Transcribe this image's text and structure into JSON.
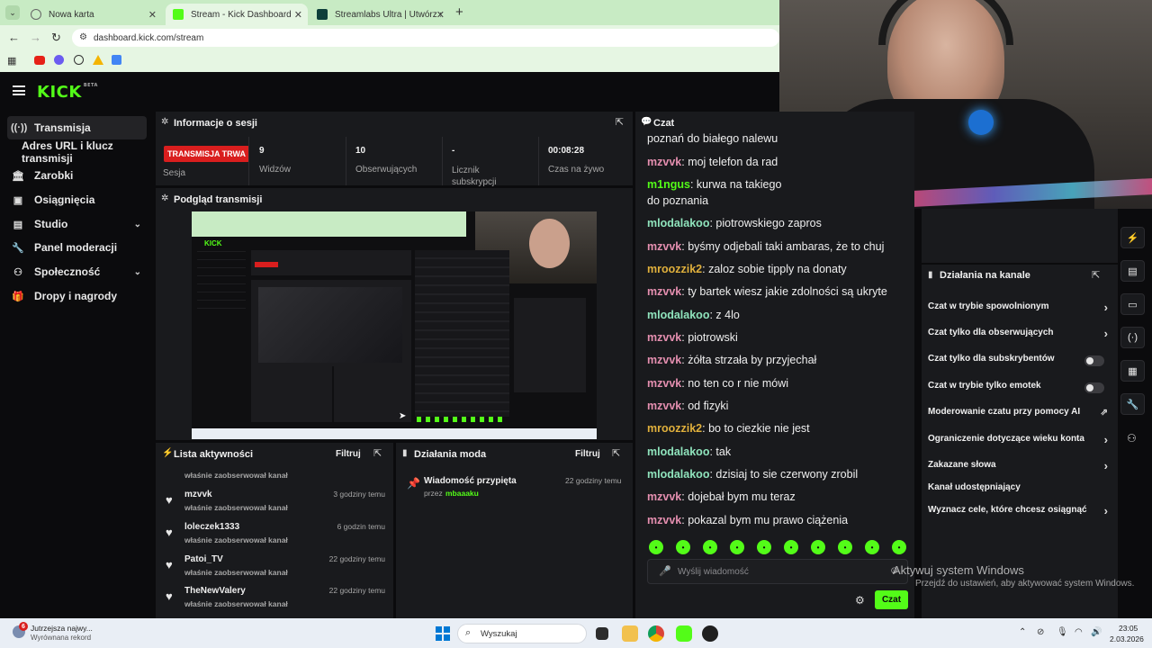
{
  "browser": {
    "tabs": [
      {
        "title": "Nowa karta"
      },
      {
        "title": "Stream - Kick Dashboard"
      },
      {
        "title": "Streamlabs Ultra | Utwórz subsk"
      }
    ],
    "url": "dashboard.kick.com/stream",
    "new_tab_label": "+"
  },
  "app": {
    "logo_text": "KICK",
    "logo_beta": "BETA"
  },
  "sidebar": {
    "items": [
      {
        "label": "Transmisja",
        "icon": "broadcast-icon"
      },
      {
        "label": "Adres URL i klucz transmisji"
      },
      {
        "label": "Zarobki",
        "icon": "bank-icon"
      },
      {
        "label": "Osiągnięcia",
        "icon": "trophy-icon"
      },
      {
        "label": "Studio",
        "icon": "studio-icon"
      },
      {
        "label": "Panel moderacji",
        "icon": "wrench-icon"
      },
      {
        "label": "Społeczność",
        "icon": "community-icon"
      },
      {
        "label": "Dropy i nagrody",
        "icon": "gift-icon"
      }
    ]
  },
  "session": {
    "title": "Informacje o sesji",
    "live_badge": "TRANSMISJA TRWA",
    "session_label": "Sesja",
    "viewers_value": "9",
    "viewers_label": "Widzów",
    "followers_value": "10",
    "followers_label": "Obserwujących",
    "subs_value": "-",
    "subs_label": "Licznik subskrypcji",
    "time_value": "00:08:28",
    "time_label": "Czas na żywo"
  },
  "preview": {
    "title": "Podgląd transmisji"
  },
  "activity": {
    "title": "Lista aktywności",
    "filter_label": "Filtruj",
    "partial_sub": "właśnie zaobserwował kanał",
    "rows": [
      {
        "name": "mzvvk",
        "sub": "właśnie zaobserwował kanał",
        "time": "3 godziny temu"
      },
      {
        "name": "loleczek1333",
        "sub": "właśnie zaobserwował kanał",
        "time": "6 godzin temu"
      },
      {
        "name": "Patoi_TV",
        "sub": "właśnie zaobserwował kanał",
        "time": "22 godziny temu"
      },
      {
        "name": "TheNewValery",
        "sub": "właśnie zaobserwował kanał",
        "time": "22 godziny temu"
      }
    ]
  },
  "mod_actions": {
    "title": "Działania moda",
    "filter_label": "Filtruj",
    "item_title": "Wiadomość przypięta",
    "item_by": "przez",
    "item_user": "mbaaaku",
    "item_time": "22 godziny temu"
  },
  "chat": {
    "title": "Czat",
    "lines": [
      {
        "user": "",
        "text": "poznań do białego nalewu",
        "color": "#efefef"
      },
      {
        "user": "mzvvk",
        "text": "moj telefon da rad",
        "color": "#e58fb0"
      },
      {
        "user": "m1ngus",
        "text": "kurwa na takiego",
        "color": "#53fc18"
      },
      {
        "user": "",
        "text": "do poznania",
        "color": "#efefef"
      },
      {
        "user": "mlodalakoo",
        "text": "piotrowskiego zapros",
        "color": "#8fe3bc"
      },
      {
        "user": "mzvvk",
        "text": "byśmy odjebali taki ambaras, że to chuj",
        "color": "#e58fb0"
      },
      {
        "user": "mroozzik2",
        "text": "zaloz sobie tipply na donaty",
        "color": "#e0b03c"
      },
      {
        "user": "mzvvk",
        "text": "ty bartek wiesz jakie zdolności są ukryte",
        "color": "#e58fb0"
      },
      {
        "user": "mlodalakoo",
        "text": "z 4lo",
        "color": "#8fe3bc"
      },
      {
        "user": "mzvvk",
        "text": "piotrowski",
        "color": "#e58fb0"
      },
      {
        "user": "mzvvk",
        "text": "żółta strzała by przyjechał",
        "color": "#e58fb0"
      },
      {
        "user": "mzvvk",
        "text": "no ten co r nie mówi",
        "color": "#e58fb0"
      },
      {
        "user": "mzvvk",
        "text": "od fizyki",
        "color": "#e58fb0"
      },
      {
        "user": "mroozzik2",
        "text": "bo to ciezkie nie jest",
        "color": "#e0b03c"
      },
      {
        "user": "mlodalakoo",
        "text": "tak",
        "color": "#8fe3bc"
      },
      {
        "user": "mlodalakoo",
        "text": "dzisiaj to sie czerwony zrobil",
        "color": "#8fe3bc"
      },
      {
        "user": "mzvvk",
        "text": "dojebał bym mu teraz",
        "color": "#e58fb0"
      },
      {
        "user": "mzvvk",
        "text": "pokazal bym mu prawo ciążenia",
        "color": "#e58fb0"
      }
    ],
    "input_placeholder": "Wyślij wiadomość",
    "send_label": "Czat"
  },
  "channel_actions": {
    "title": "Działania na kanale",
    "items": [
      {
        "label": "Czat w trybie spowolnionym",
        "control": "arrow"
      },
      {
        "label": "Czat tylko dla obserwujących",
        "control": "arrow"
      },
      {
        "label": "Czat tylko dla subskrybentów",
        "control": "toggle"
      },
      {
        "label": "Czat w trybie tylko emotek",
        "control": "toggle"
      },
      {
        "label": "Moderowanie czatu przy pomocy AI",
        "control": "external"
      },
      {
        "label": "Ograniczenie dotyczące wieku konta",
        "control": "arrow"
      },
      {
        "label": "Zakazane słowa",
        "control": "arrow"
      },
      {
        "label": "Kanał udostępniający",
        "control": "none"
      },
      {
        "label": "Wyznacz cele, które chcesz osiągnąć",
        "control": "arrow"
      }
    ]
  },
  "windows_activation": {
    "title": "Aktywuj system Windows",
    "subtitle": "Przejdź do ustawień, aby aktywować system Windows."
  },
  "taskbar": {
    "notification_badge": "6",
    "news_title": "Jutrzejsza najwy...",
    "news_subtitle": "Wyrównana rekord",
    "search_placeholder": "Wyszukaj",
    "time": "23:05",
    "date": "2.03.2026"
  },
  "colors": {
    "kick_green": "#53fc18",
    "panel_bg": "#191a1d",
    "page_bg": "#0b0b0d",
    "live_red": "#d91e1e"
  }
}
